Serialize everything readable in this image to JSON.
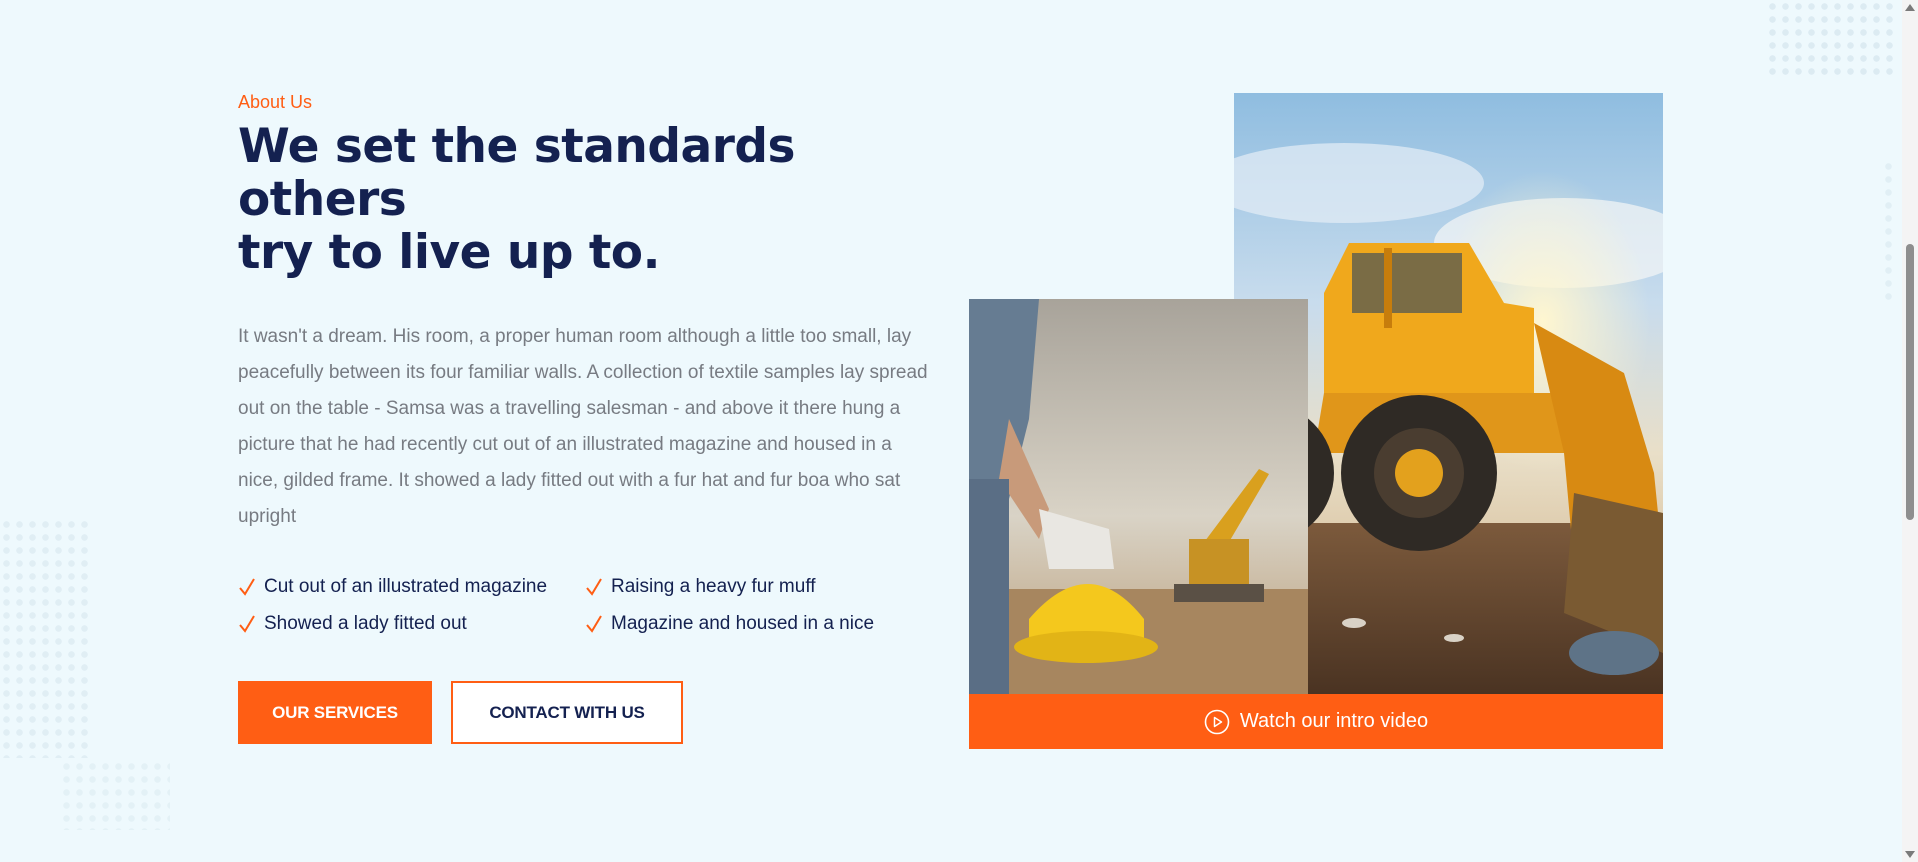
{
  "about": {
    "eyebrow": "About Us",
    "headline_line1": "We set the standards others",
    "headline_line2": "try to live up to.",
    "paragraph": "It wasn't a dream. His room, a proper human room although a little too small, lay peacefully between its four familiar walls. A collection of textile samples lay spread out on the table - Samsa was a travelling salesman - and above it there hung a picture that he had recently cut out of an illustrated magazine and housed in a nice, gilded frame. It showed a lady fitted out with a fur hat and fur boa who sat upright"
  },
  "checklist": [
    "Cut out of an illustrated magazine",
    "Raising a heavy fur muff",
    "Showed a lady fitted out",
    "Magazine and housed in a nice"
  ],
  "buttons": {
    "primary": "OUR SERVICES",
    "secondary": "CONTACT WITH US"
  },
  "video": {
    "label": "Watch our intro video",
    "icon": "play-circle-icon"
  },
  "images": {
    "tall": "wheel-loader-photo",
    "front": "worker-with-helmet-photo"
  },
  "colors": {
    "accent": "#ff5e14",
    "heading": "#142150",
    "body_text": "#777b82",
    "background": "#eef9fd"
  }
}
